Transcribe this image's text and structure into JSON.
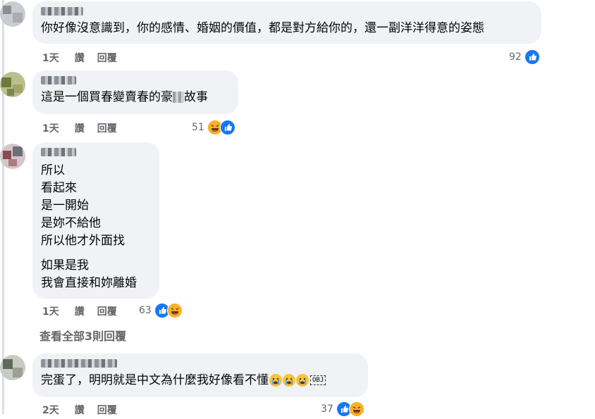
{
  "comments": [
    {
      "text_lines": [
        "你好像沒意識到，你的感情、婚姻的價值，都是對方給你的，還一副洋洋得意的姿態"
      ],
      "time": "1天",
      "like_label": "讚",
      "reply_label": "回覆",
      "reaction_count": "92",
      "reactions": [
        "like-icon"
      ]
    },
    {
      "text_before": "這是一個買春變賣春的豪",
      "text_after": "故事",
      "time": "1天",
      "like_label": "讚",
      "reply_label": "回覆",
      "reaction_count": "51",
      "reactions": [
        "haha-icon",
        "like-icon"
      ]
    },
    {
      "text_lines": [
        "所以",
        "看起來",
        "是一開始",
        "是妳不給他",
        "所以他才外面找"
      ],
      "text_lines_2": [
        "如果是我",
        "我會直接和妳離婚"
      ],
      "time": "1天",
      "like_label": "讚",
      "reply_label": "回覆",
      "reaction_count": "63",
      "reactions": [
        "like-icon",
        "haha-icon"
      ]
    },
    {
      "text": "完蛋了，明明就是中文為什麼我好像看不懂",
      "ok_label": "OBJ",
      "time": "2天",
      "like_label": "讚",
      "reply_label": "回覆",
      "reaction_count": "37",
      "reactions": [
        "like-icon",
        "haha-icon"
      ]
    }
  ],
  "view_all_replies": "查看全部3則回覆",
  "colors": {
    "bubble": "#f0f2f5",
    "like": "#1877f2",
    "haha": "#f7b125",
    "meta": "#65676b"
  }
}
